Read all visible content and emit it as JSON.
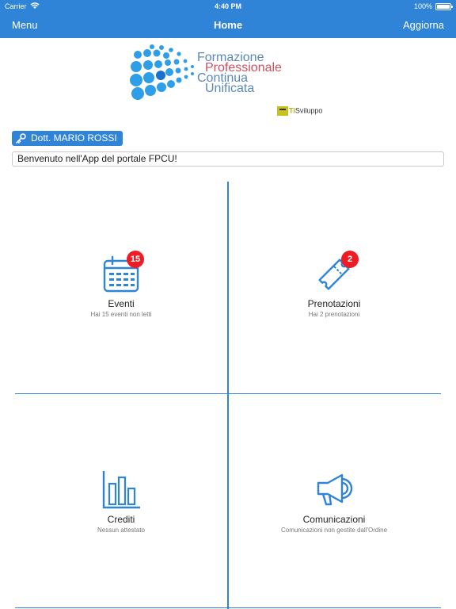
{
  "status_bar": {
    "carrier": "Carrier",
    "time": "4:40 PM",
    "battery": "100%"
  },
  "nav": {
    "left": "Menu",
    "title": "Home",
    "right": "Aggiorna"
  },
  "logo": {
    "line1": "Formazione",
    "line2": "Professionale",
    "line3": "Continua",
    "line4": "Unificata",
    "sponsor_prefix": "Ti",
    "sponsor_rest": "Sviluppo"
  },
  "user": {
    "name": "Dott. MARIO ROSSI",
    "welcome": "Benvenuto nell'App del portale FPCU!"
  },
  "tiles": [
    {
      "title": "Eventi",
      "subtitle": "Hai 15 eventi non letti",
      "badge": "15",
      "icon": "calendar-icon"
    },
    {
      "title": "Prenotazioni",
      "subtitle": "Hai 2 prenotazioni",
      "badge": "2",
      "icon": "ticket-icon"
    },
    {
      "title": "Crediti",
      "subtitle": "Nessun attestato",
      "icon": "bar-chart-icon"
    },
    {
      "title": "Comunicazioni",
      "subtitle": "Comunicazioni non gestite dall'Ordine",
      "icon": "megaphone-icon"
    }
  ],
  "colors": {
    "accent": "#2f84d8",
    "badge": "#ee1c24",
    "logo_blue": "#5b88b9",
    "logo_red": "#cd5060"
  }
}
